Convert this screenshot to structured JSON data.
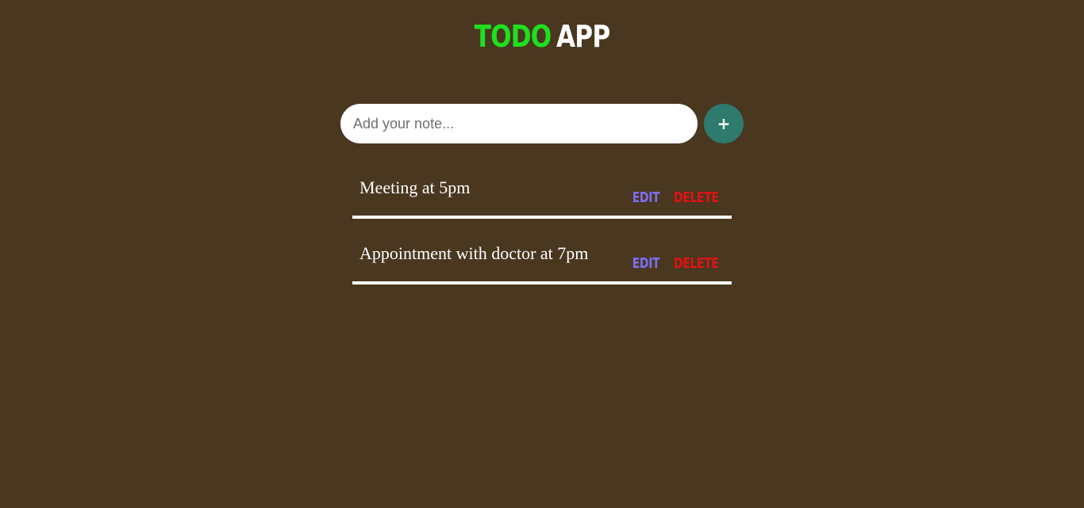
{
  "header": {
    "title_part1": "TODO",
    "title_part2": "APP"
  },
  "input": {
    "placeholder": "Add your note...",
    "value": ""
  },
  "add_button": {
    "label": "+"
  },
  "todos": [
    {
      "text": "Meeting at 5pm",
      "edit_label": "EDIT",
      "delete_label": "DELETE"
    },
    {
      "text": "Appointment with doctor at 7pm",
      "edit_label": "EDIT",
      "delete_label": "DELETE"
    }
  ],
  "colors": {
    "background": "#4a3720",
    "title_accent": "#1fe01f",
    "title_main": "#ffffff",
    "add_button": "#2e7a6c",
    "edit": "#7b6ff0",
    "delete": "#e01414"
  }
}
